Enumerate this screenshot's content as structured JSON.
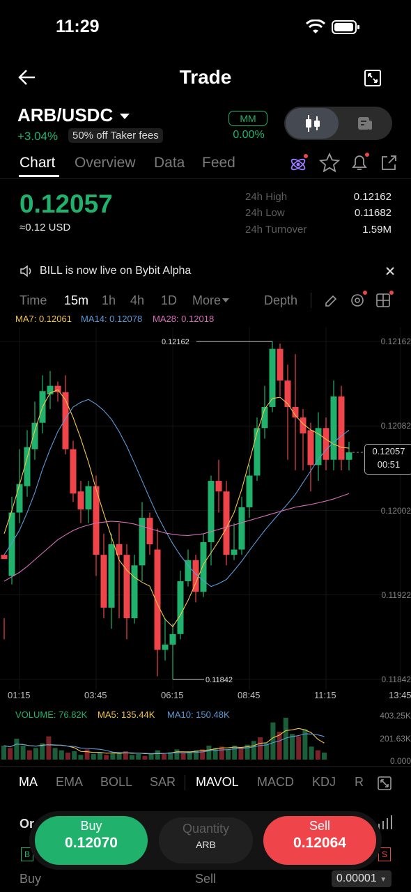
{
  "status": {
    "time": "11:29"
  },
  "nav": {
    "title": "Trade"
  },
  "pair": {
    "name": "ARB/USDC",
    "change": "+3.04%",
    "fee_badge": "50% off Taker fees",
    "mm_label": "MM",
    "mm_value": "0.00%"
  },
  "tabs": [
    "Chart",
    "Overview",
    "Data",
    "Feed"
  ],
  "price": {
    "last": "0.12057",
    "usd": "≈0.12 USD"
  },
  "stats": [
    {
      "label": "24h High",
      "value": "0.12162"
    },
    {
      "label": "24h Low",
      "value": "0.11682"
    },
    {
      "label": "24h Turnover",
      "value": "1.59M"
    }
  ],
  "announcement": {
    "text": "BILL is now live on Bybit Alpha"
  },
  "timeframes": {
    "items": [
      "Time",
      "15m",
      "1h",
      "4h",
      "1D",
      "More"
    ],
    "active": "15m",
    "depth": "Depth"
  },
  "ma_legend": {
    "ma7": "MA7: 0.12061",
    "ma14": "MA14: 0.12078",
    "ma28": "MA28: 0.12018"
  },
  "chart_data": {
    "type": "candlestick",
    "y_ticks": [
      "0.12162",
      "0.12082",
      "0.12002",
      "0.11922",
      "0.11842"
    ],
    "ylim": [
      0.11842,
      0.12162
    ],
    "x_ticks": [
      "01:15",
      "03:45",
      "06:15",
      "08:45",
      "11:15",
      "13:45"
    ],
    "high_label": "0.12162",
    "low_label": "0.11842",
    "last_price_label": "0.12057",
    "countdown": "00:51",
    "candles": [
      [
        0.1196,
        0.11956,
        0.119,
        0.1188
      ],
      [
        0.1194,
        0.12,
        0.12015,
        0.11932
      ],
      [
        0.12,
        0.12027,
        0.1206,
        0.1199
      ],
      [
        0.12025,
        0.12062,
        0.12078,
        0.12015
      ],
      [
        0.1206,
        0.12085,
        0.12105,
        0.1205
      ],
      [
        0.12085,
        0.12115,
        0.1213,
        0.12075
      ],
      [
        0.12112,
        0.1212,
        0.12134,
        0.12098
      ],
      [
        0.1212,
        0.12114,
        0.12124,
        0.12105
      ],
      [
        0.12114,
        0.1206,
        0.1213,
        0.12055
      ],
      [
        0.1206,
        0.12018,
        0.12068,
        0.1201
      ],
      [
        0.1202,
        0.12003,
        0.1203,
        0.1199
      ],
      [
        0.12003,
        0.12025,
        0.1203,
        0.1199
      ],
      [
        0.12025,
        0.1196,
        0.12035,
        0.1194
      ],
      [
        0.1196,
        0.1191,
        0.1198,
        0.119
      ],
      [
        0.1191,
        0.1197,
        0.1198,
        0.1189
      ],
      [
        0.1197,
        0.1196,
        0.1199,
        0.119
      ],
      [
        0.1196,
        0.119,
        0.1197,
        0.1188
      ],
      [
        0.119,
        0.1195,
        0.1196,
        0.11895
      ],
      [
        0.1195,
        0.11995,
        0.1201,
        0.11935
      ],
      [
        0.11995,
        0.1197,
        0.12,
        0.1196
      ],
      [
        0.11965,
        0.1187,
        0.11985,
        0.11845
      ],
      [
        0.1187,
        0.11875,
        0.119,
        0.1186
      ],
      [
        0.11875,
        0.11885,
        0.11895,
        0.11842
      ],
      [
        0.11885,
        0.11935,
        0.11945,
        0.1188
      ],
      [
        0.11935,
        0.11955,
        0.11965,
        0.1193
      ],
      [
        0.11955,
        0.11925,
        0.1196,
        0.11915
      ],
      [
        0.11925,
        0.11972,
        0.1198,
        0.1192
      ],
      [
        0.11972,
        0.1203,
        0.12035,
        0.1195
      ],
      [
        0.1203,
        0.1202,
        0.1205,
        0.12
      ],
      [
        0.1202,
        0.1196,
        0.1203,
        0.1195
      ],
      [
        0.1196,
        0.11965,
        0.1199,
        0.11955
      ],
      [
        0.11965,
        0.12005,
        0.12015,
        0.1196
      ],
      [
        0.12005,
        0.12035,
        0.12045,
        0.11995
      ],
      [
        0.12035,
        0.1208,
        0.1209,
        0.1203
      ],
      [
        0.1208,
        0.121,
        0.1212,
        0.1207
      ],
      [
        0.121,
        0.12155,
        0.12162,
        0.12095
      ],
      [
        0.12155,
        0.12125,
        0.1216,
        0.1211
      ],
      [
        0.12125,
        0.121,
        0.1214,
        0.1205
      ],
      [
        0.121,
        0.1209,
        0.1215,
        0.1204
      ],
      [
        0.1209,
        0.12075,
        0.12098,
        0.1204
      ],
      [
        0.12078,
        0.12045,
        0.12085,
        0.1202
      ],
      [
        0.12045,
        0.1208,
        0.12095,
        0.1203
      ],
      [
        0.1208,
        0.1205,
        0.1209,
        0.1204
      ],
      [
        0.1205,
        0.1211,
        0.12125,
        0.1204
      ],
      [
        0.1211,
        0.1205,
        0.1212,
        0.1204
      ],
      [
        0.1205,
        0.12057,
        0.12067,
        0.1204
      ]
    ],
    "ma7": [
      0.1198,
      0.1201,
      0.12045,
      0.1208,
      0.1211,
      0.12118,
      0.12105,
      0.1208,
      0.1205,
      0.12015,
      0.11985,
      0.11955,
      0.11942,
      0.11935,
      0.1193,
      0.11905,
      0.1189,
      0.11905,
      0.11925,
      0.1195,
      0.11965,
      0.1198,
      0.12,
      0.1203,
      0.1207,
      0.121,
      0.12112,
      0.12105,
      0.1209,
      0.1208,
      0.12075,
      0.12068,
      0.12062,
      0.12061
    ],
    "ma14": [
      0.1196,
      0.1198,
      0.1201,
      0.1205,
      0.1208,
      0.121,
      0.12108,
      0.121,
      0.12085,
      0.1206,
      0.1203,
      0.12,
      0.11975,
      0.11955,
      0.1194,
      0.1193,
      0.11935,
      0.1195,
      0.11968,
      0.11985,
      0.12,
      0.12015,
      0.12035,
      0.12055,
      0.12068,
      0.12078
    ],
    "ma28": [
      0.11935,
      0.11945,
      0.1196,
      0.11975,
      0.11985,
      0.1199,
      0.11992,
      0.1199,
      0.11985,
      0.1198,
      0.11978,
      0.1198,
      0.11985,
      0.1199,
      0.11995,
      0.12,
      0.12005,
      0.12008,
      0.12012,
      0.12018
    ]
  },
  "volume_legend": {
    "volume": "VOLUME: 76.82K",
    "ma5": "MA5: 135.44K",
    "ma10": "MA10: 150.48K"
  },
  "volume_axis": [
    "403.25K",
    "201.63K",
    "0.000"
  ],
  "volume_data": [
    30,
    25,
    45,
    30,
    20,
    25,
    35,
    50,
    25,
    20,
    15,
    18,
    10,
    22,
    12,
    15,
    10,
    14,
    16,
    18,
    10,
    12,
    8,
    14,
    20,
    12,
    16,
    22,
    14,
    18,
    20,
    22,
    30,
    25,
    28,
    22,
    30,
    26,
    32,
    40,
    48,
    35,
    80,
    60,
    90,
    55,
    50,
    65,
    28,
    20,
    15
  ],
  "indicators": {
    "items": [
      "MA",
      "EMA",
      "BOLL",
      "SAR",
      "MAVOL",
      "MACD",
      "KDJ",
      "R"
    ],
    "active": [
      "MA",
      "MAVOL"
    ]
  },
  "order": {
    "buy_label": "Buy",
    "buy_price": "0.12070",
    "qty_label": "Quantity",
    "qty_unit": "ARB",
    "sell_label": "Sell",
    "sell_price": "0.12064"
  },
  "bottom": {
    "buy": "Buy",
    "sell": "Sell",
    "precision": "0.00001",
    "partial_tab": "Or"
  }
}
